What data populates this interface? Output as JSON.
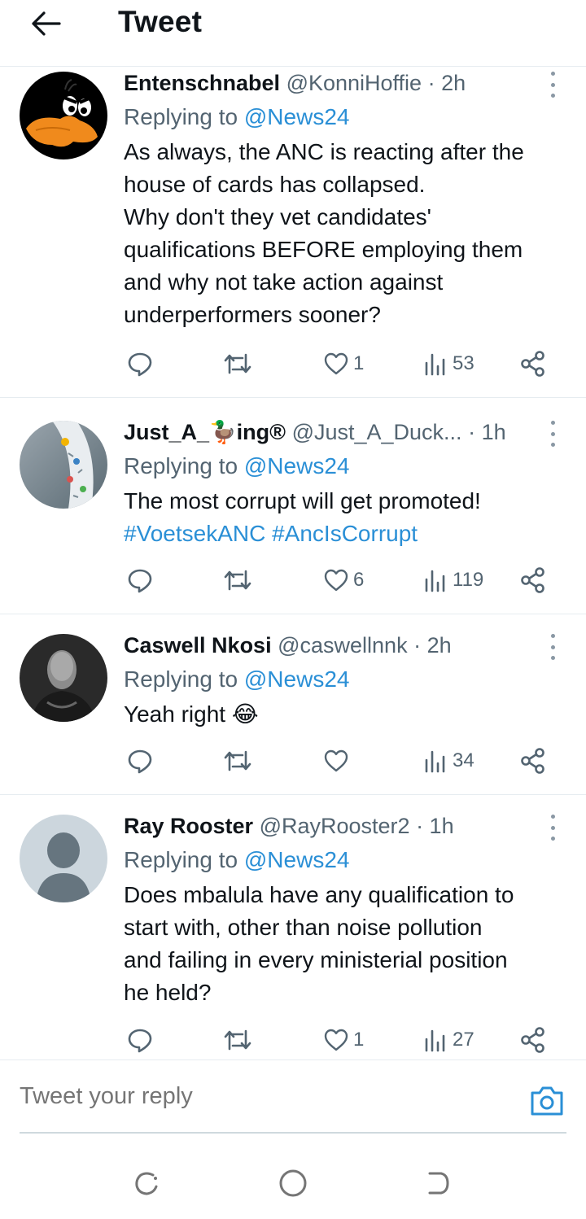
{
  "header": {
    "title": "Tweet",
    "back_icon": "arrow-left-icon"
  },
  "tweets": [
    {
      "name": "Entenschnabel",
      "handle": "@KonniHoffie",
      "time": "· 2h",
      "replying_prefix": "Replying to ",
      "replying_to": "@News24",
      "lines": [
        "As always, the ANC is reacting after the",
        "house of cards has collapsed.",
        "Why don't they vet candidates'",
        "qualifications BEFORE employing them",
        "and why not take action against",
        "underperformers sooner?"
      ],
      "likes": "1",
      "views": "53",
      "avatar": "daffy-duck-avatar"
    },
    {
      "name": "Just_A_🦆ing®",
      "handle": "@Just_A_Duck...",
      "time": "· 1h",
      "replying_prefix": "Replying to ",
      "replying_to": "@News24",
      "text": "The most corrupt will get promoted!",
      "hashtags": [
        "#VoetsekANC",
        "#AncIsCorrupt"
      ],
      "likes": "6",
      "views": "119",
      "avatar": "patterned-avatar"
    },
    {
      "name": "Caswell Nkosi",
      "handle": "@caswellnnk",
      "time": "· 2h",
      "replying_prefix": "Replying to ",
      "replying_to": "@News24",
      "text": "Yeah right 😂",
      "likes": "",
      "views": "34",
      "avatar": "photo-avatar"
    },
    {
      "name": "Ray Rooster",
      "handle": "@RayRooster2",
      "time": "· 1h",
      "replying_prefix": "Replying to ",
      "replying_to": "@News24",
      "lines": [
        "Does mbalula have any qualification to",
        "start with, other than noise pollution",
        "and failing in every ministerial position",
        "he held?"
      ],
      "likes": "1",
      "views": "27",
      "avatar": "default-avatar"
    }
  ],
  "composer": {
    "placeholder": "Tweet your reply"
  },
  "colors": {
    "accent": "#2a8fd6",
    "muted": "#536471",
    "text": "#0f1419",
    "divider": "#e6ecf0"
  }
}
